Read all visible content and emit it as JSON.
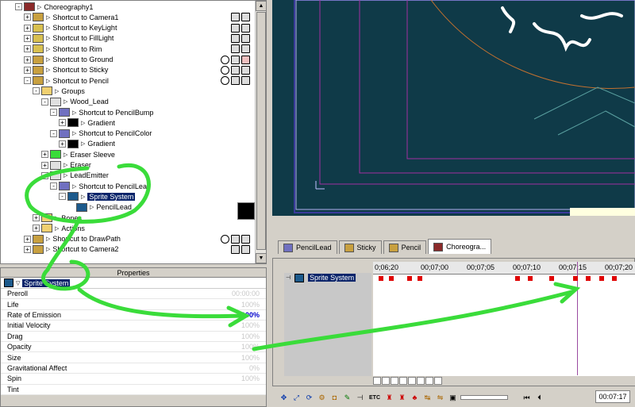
{
  "tree": {
    "rows": [
      {
        "label": "Choreography1",
        "indent": 0,
        "exp": "-",
        "icon": "choreo"
      },
      {
        "label": "Shortcut to Camera1",
        "indent": 1,
        "exp": "+",
        "icon": "actor",
        "tgl": [
          "sq",
          "sq"
        ]
      },
      {
        "label": "Shortcut to KeyLight",
        "indent": 1,
        "exp": "+",
        "icon": "light",
        "tgl": [
          "sq",
          "sq"
        ]
      },
      {
        "label": "Shortcut to FillLight",
        "indent": 1,
        "exp": "+",
        "icon": "light",
        "tgl": [
          "sq",
          "sq"
        ]
      },
      {
        "label": "Shortcut to Rim",
        "indent": 1,
        "exp": "+",
        "icon": "light",
        "tgl": [
          "sq",
          "sq"
        ]
      },
      {
        "label": "Shortcut to Ground",
        "indent": 1,
        "exp": "+",
        "icon": "actor",
        "tgl": [
          "o",
          "sq",
          "x"
        ]
      },
      {
        "label": "Shortcut to Sticky",
        "indent": 1,
        "exp": "+",
        "icon": "actor",
        "tgl": [
          "o",
          "sq",
          "sq"
        ]
      },
      {
        "label": "Shortcut to Pencil",
        "indent": 1,
        "exp": "-",
        "icon": "actor",
        "tgl": [
          "o",
          "sq",
          "sq"
        ]
      },
      {
        "label": "Groups",
        "indent": 2,
        "exp": "-",
        "icon": "folder"
      },
      {
        "label": "Wood_Lead",
        "indent": 3,
        "exp": "-",
        "icon": "group"
      },
      {
        "label": "Shortcut to PencilBump",
        "indent": 4,
        "exp": "-",
        "icon": "mat"
      },
      {
        "label": "Gradient",
        "indent": 5,
        "exp": "+",
        "icon": "dark"
      },
      {
        "label": "Shortcut to PencilColor",
        "indent": 4,
        "exp": "-",
        "icon": "mat"
      },
      {
        "label": "Gradient",
        "indent": 5,
        "exp": "+",
        "icon": "dark"
      },
      {
        "label": "Eraser Sleeve",
        "indent": 3,
        "exp": "+",
        "icon": "green"
      },
      {
        "label": "Eraser",
        "indent": 3,
        "exp": "+",
        "icon": "group"
      },
      {
        "label": "LeadEmitter",
        "indent": 3,
        "exp": "-",
        "icon": "group"
      },
      {
        "label": "Shortcut to PencilLead",
        "indent": 4,
        "exp": "-",
        "icon": "mat"
      },
      {
        "label": "Sprite System",
        "indent": 5,
        "exp": "-",
        "icon": "sprite",
        "selected": true
      },
      {
        "label": "PencilLead",
        "indent": 6,
        "exp": "",
        "icon": "sprite"
      },
      {
        "label": "Bones",
        "indent": 2,
        "exp": "+",
        "icon": "folder"
      },
      {
        "label": "Actions",
        "indent": 2,
        "exp": "+",
        "icon": "folder"
      },
      {
        "label": "Shortcut to DrawPath",
        "indent": 1,
        "exp": "+",
        "icon": "actor",
        "tgl": [
          "o",
          "sq",
          "sq"
        ]
      },
      {
        "label": "Shortcut to Camera2",
        "indent": 1,
        "exp": "+",
        "icon": "actor",
        "tgl": [
          "sq",
          "sq"
        ]
      }
    ]
  },
  "properties": {
    "title": "Properties",
    "header": "Sprite System",
    "rows": [
      {
        "name": "Preroll",
        "value": "00:00:00",
        "active": false
      },
      {
        "name": "Life",
        "value": "100%",
        "active": false
      },
      {
        "name": "Rate of Emission",
        "value": "100%",
        "active": true
      },
      {
        "name": "Initial Velocity",
        "value": "100%",
        "active": false
      },
      {
        "name": "Drag",
        "value": "100%",
        "active": false
      },
      {
        "name": "Opacity",
        "value": "100%",
        "active": false
      },
      {
        "name": "Size",
        "value": "100%",
        "active": false
      },
      {
        "name": "Gravitational Affect",
        "value": "0%",
        "active": false
      },
      {
        "name": "Spin",
        "value": "100%",
        "active": false
      },
      {
        "name": "Tint",
        "value": "",
        "active": false
      }
    ]
  },
  "tabs": [
    {
      "label": "PencilLead",
      "icon": "mat",
      "active": false
    },
    {
      "label": "Sticky",
      "icon": "actor",
      "active": false
    },
    {
      "label": "Pencil",
      "icon": "actor",
      "active": false
    },
    {
      "label": "Choreogra...",
      "icon": "choreo",
      "active": true
    }
  ],
  "timeline": {
    "track_label": "Sprite System",
    "ticks": [
      "0;06;20",
      "00;07;00",
      "00;07;05",
      "00;07;10",
      "00;07;15",
      "00;07;20"
    ],
    "keyframes": [
      0.02,
      0.06,
      0.13,
      0.17,
      0.54,
      0.59,
      0.67,
      0.76,
      0.81,
      0.86,
      0.91
    ],
    "playhead": 0.775
  },
  "toolbar": {
    "etc_label": "ETC",
    "time": "00:07:17"
  },
  "colors": {
    "annotation": "#3adc3a",
    "selection": "#0a246a",
    "key": "#e00000",
    "viewport": "#0f3a48"
  }
}
